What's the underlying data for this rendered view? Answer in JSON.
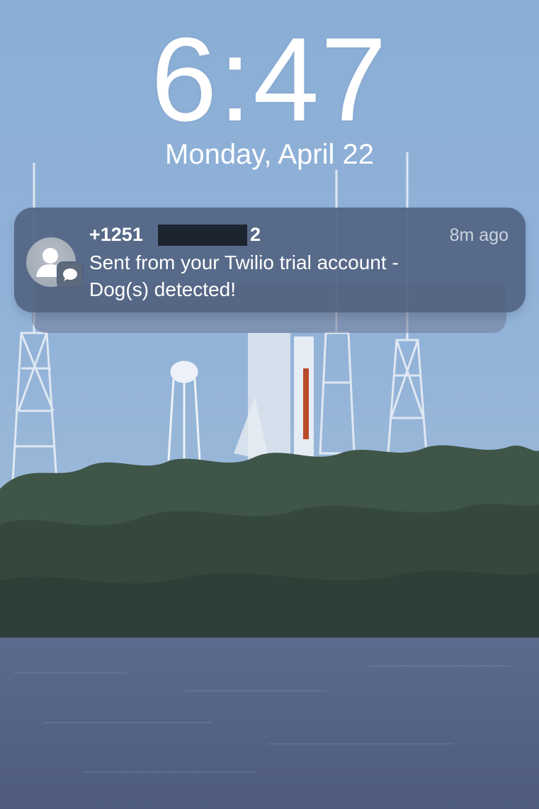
{
  "lockscreen": {
    "time": "6:47",
    "date": "Monday, April 22"
  },
  "notification": {
    "sender": "+1251",
    "sender_suffix": "2",
    "time_ago": "8m ago",
    "message_line1": "Sent from your Twilio trial account -",
    "message_line2": "Dog(s) detected!",
    "avatar_icon": "contact-icon",
    "badge_icon": "messages-icon"
  }
}
